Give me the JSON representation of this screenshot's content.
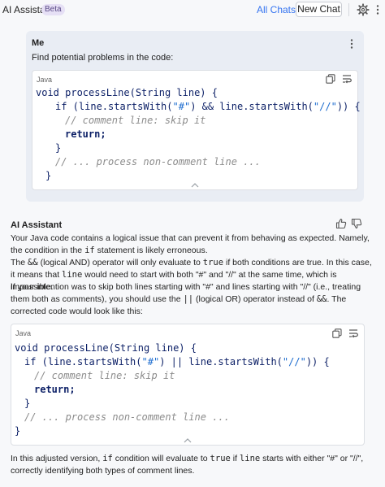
{
  "header": {
    "title": "AI Assistant",
    "beta": "Beta",
    "all_chats": "All Chats",
    "new_chat": "New Chat"
  },
  "user_message": {
    "author": "Me",
    "text": "Find potential problems in the code:",
    "code_lang": "Java",
    "code": {
      "l1": "void processLine(String line) {",
      "l2a": "if (line.startsWith(",
      "l2s1": "\"#\"",
      "l2b": ") && line.startsWith(",
      "l2s2": "\"//\"",
      "l2c": ")) {",
      "l3": "// comment line: skip it",
      "l4": "return;",
      "l5": "}",
      "l6": "// ... process non-comment line ...",
      "l7": "}"
    }
  },
  "assistant_message": {
    "author": "AI Assistant",
    "p1_a": "Your Java code contains a logical issue that can prevent it from behaving as expected. Namely, the condition in the ",
    "p1_code": "if",
    "p1_b": " statement is likely erroneous.",
    "p2_a": "The ",
    "p2_code1": "&&",
    "p2_b": " (logical AND) operator will only evaluate to ",
    "p2_code2": "true",
    "p2_c": " if both conditions are true. In this case, it means that ",
    "p2_code3": "line",
    "p2_d": " would need to start with both \"#\" and \"//\" at the same time, which is impossible.",
    "p3_a": "If your intention was to skip both lines starting with \"#\" and lines starting with \"//\" (i.e., treating them both as comments), you should use the ",
    "p3_code1": "||",
    "p3_b": " (logical OR) operator instead of ",
    "p3_code2": "&&",
    "p3_c": ". The corrected code would look like this:",
    "code_lang": "Java",
    "code": {
      "l1": "void processLine(String line) {",
      "l2a": "if (line.startsWith(",
      "l2s1": "\"#\"",
      "l2b": ") || line.startsWith(",
      "l2s2": "\"//\"",
      "l2c": ")) {",
      "l3": "// comment line: skip it",
      "l4": "return;",
      "l5": "}",
      "l6": "// ... process non-comment line ...",
      "l7": "}"
    },
    "p4_a": "In this adjusted version, ",
    "p4_code1": "if",
    "p4_b": " condition will evaluate to ",
    "p4_code2": "true",
    "p4_c": " if ",
    "p4_code3": "line",
    "p4_d": " starts with either \"#\" or \"//\", correctly identifying both types of comment lines."
  },
  "colors": {
    "accent": "#3574f0",
    "user_card_bg": "#e9edf4",
    "code_keyword": "#0b1f66",
    "code_string": "#1c6ccf",
    "code_comment": "#8c8c8c"
  },
  "icons": [
    "gear-icon",
    "more-icon",
    "kebab-icon",
    "copy-icon",
    "wrap-icon",
    "chevron-up-icon",
    "thumb-up-icon",
    "thumb-down-icon"
  ]
}
